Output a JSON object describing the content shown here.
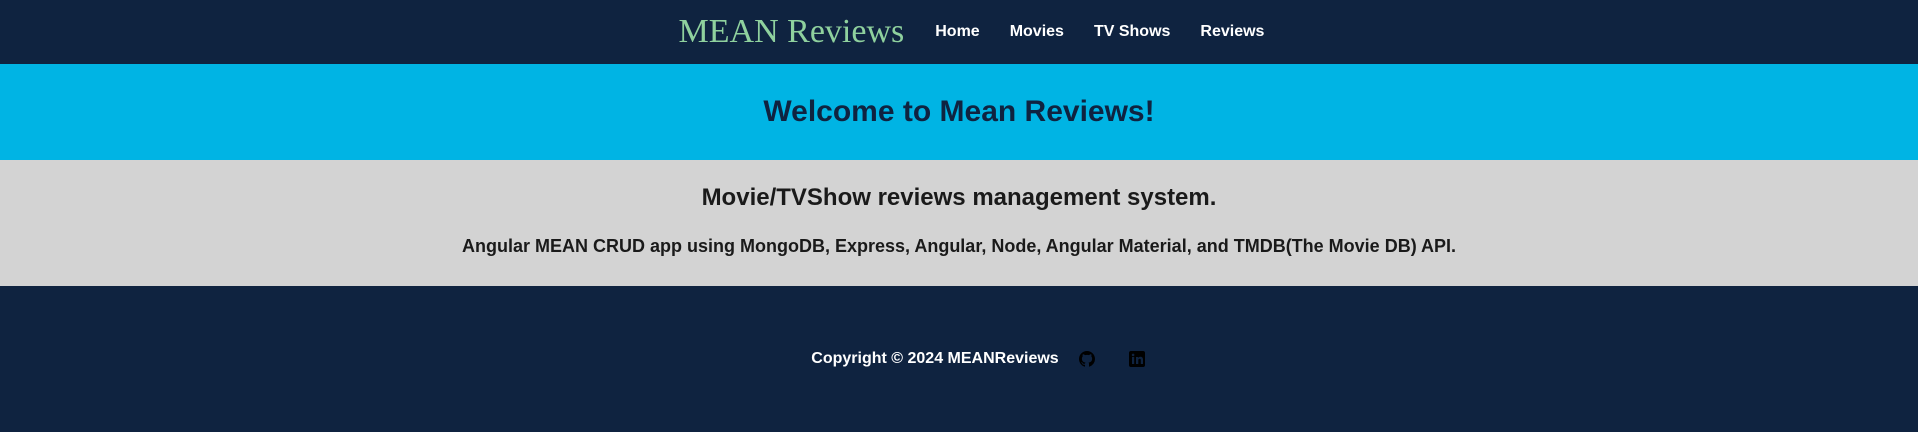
{
  "navbar": {
    "brand": "MEAN Reviews",
    "links": [
      "Home",
      "Movies",
      "TV Shows",
      "Reviews"
    ]
  },
  "hero": {
    "title": "Welcome to Mean Reviews!"
  },
  "about": {
    "heading": "Movie/TVShow reviews management system.",
    "description": "Angular MEAN CRUD app using MongoDB, Express, Angular, Node, Angular Material, and TMDB(The Movie DB) API."
  },
  "footer": {
    "copyright": "Copyright © 2024 MEANReviews",
    "icons": [
      "github-icon",
      "linkedin-icon"
    ]
  },
  "colors": {
    "navy": "#0f2340",
    "brand_green": "#8fd19e",
    "hero_blue": "#00b4e4",
    "about_gray": "#d3d3d3"
  }
}
